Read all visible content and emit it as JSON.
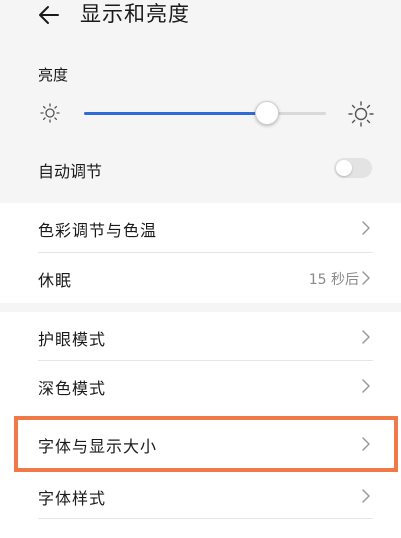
{
  "header": {
    "title": "显示和亮度",
    "back_icon": "back-arrow-icon"
  },
  "brightness": {
    "label": "亮度",
    "level_percent": 75,
    "auto_label": "自动调节",
    "auto_enabled": false,
    "accent_color": "#2f6bd8"
  },
  "group1": {
    "items": [
      {
        "label": "色彩调节与色温",
        "value": ""
      },
      {
        "label": "休眠",
        "value": "15 秒后"
      }
    ]
  },
  "group2": {
    "items": [
      {
        "label": "护眼模式"
      },
      {
        "label": "深色模式"
      },
      {
        "label": "字体与显示大小"
      },
      {
        "label": "字体样式"
      }
    ]
  },
  "highlight_color": "#ef7a47"
}
